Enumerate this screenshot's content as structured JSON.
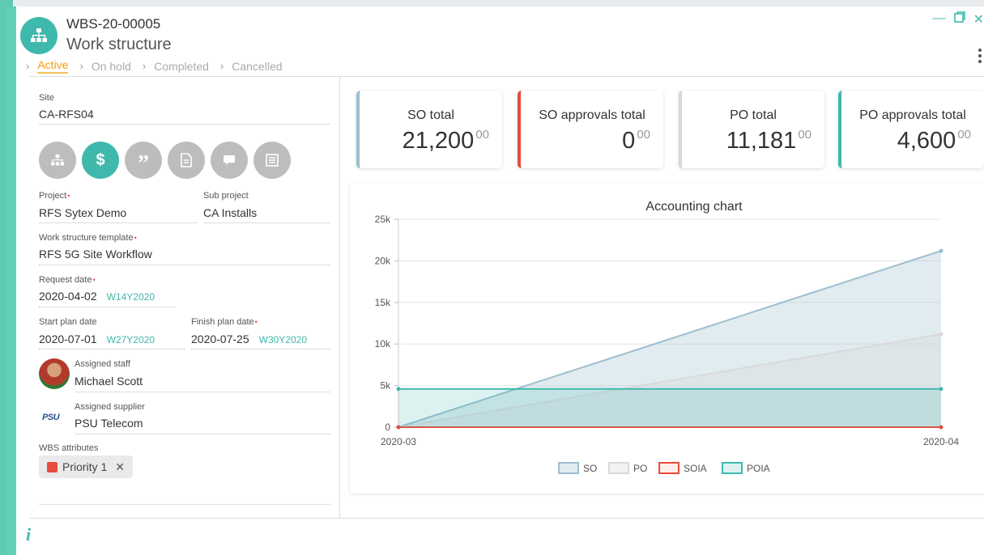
{
  "header": {
    "code": "WBS-20-00005",
    "title": "Work structure",
    "statuses": [
      {
        "label": "Active",
        "active": true
      },
      {
        "label": "On hold",
        "active": false
      },
      {
        "label": "Completed",
        "active": false
      },
      {
        "label": "Cancelled",
        "active": false
      }
    ],
    "icon": "sitemap-icon"
  },
  "left": {
    "site_label": "Site",
    "site_value": "CA-RFS04",
    "action_icons": [
      "sitemap-icon",
      "dollar-icon",
      "quote-icon",
      "document-icon",
      "comment-icon",
      "list-icon"
    ],
    "project_label": "Project",
    "project_value": "RFS Sytex Demo",
    "subproject_label": "Sub project",
    "subproject_value": "CA Installs",
    "template_label": "Work structure template",
    "template_value": "RFS 5G Site Workflow",
    "request_label": "Request date",
    "request_value": "2020-04-02",
    "request_week": "W14Y2020",
    "start_label": "Start plan date",
    "start_value": "2020-07-01",
    "start_week": "W27Y2020",
    "finish_label": "Finish plan date",
    "finish_value": "2020-07-25",
    "finish_week": "W30Y2020",
    "staff_label": "Assigned staff",
    "staff_value": "Michael Scott",
    "supplier_label": "Assigned supplier",
    "supplier_value": "PSU Telecom",
    "supplier_logo": "PSU",
    "attributes_label": "WBS attributes",
    "attribute_tag": "Priority 1",
    "attribute_color": "#e74c3c"
  },
  "kpis": [
    {
      "title": "SO total",
      "value": "21,200",
      "decimals": "00",
      "color": "#9dbfd0"
    },
    {
      "title": "SO approvals total",
      "value": "0",
      "decimals": "00",
      "color": "#e74c3c"
    },
    {
      "title": "PO total",
      "value": "11,181",
      "decimals": "00",
      "color": "#d7d7d7"
    },
    {
      "title": "PO approvals total",
      "value": "4,600",
      "decimals": "00",
      "color": "#3fb9ac"
    }
  ],
  "chart_data": {
    "type": "area",
    "title": "Accounting chart",
    "x": [
      "2020-03",
      "2020-04"
    ],
    "ylim": [
      0,
      25000
    ],
    "yticks": [
      "0",
      "5k",
      "10k",
      "15k",
      "20k",
      "25k"
    ],
    "ytick_values": [
      0,
      5000,
      10000,
      15000,
      20000,
      25000
    ],
    "grid": true,
    "legend": "bottom",
    "series": [
      {
        "name": "SO",
        "values": [
          0,
          21200
        ],
        "color": "#9dbfd0"
      },
      {
        "name": "PO",
        "values": [
          0,
          11181
        ],
        "color": "#d9d9d9"
      },
      {
        "name": "SOIA",
        "values": [
          0,
          0
        ],
        "color": "#e74c3c"
      },
      {
        "name": "POIA",
        "values": [
          4600,
          4600
        ],
        "color": "#3fb9ac"
      }
    ]
  }
}
